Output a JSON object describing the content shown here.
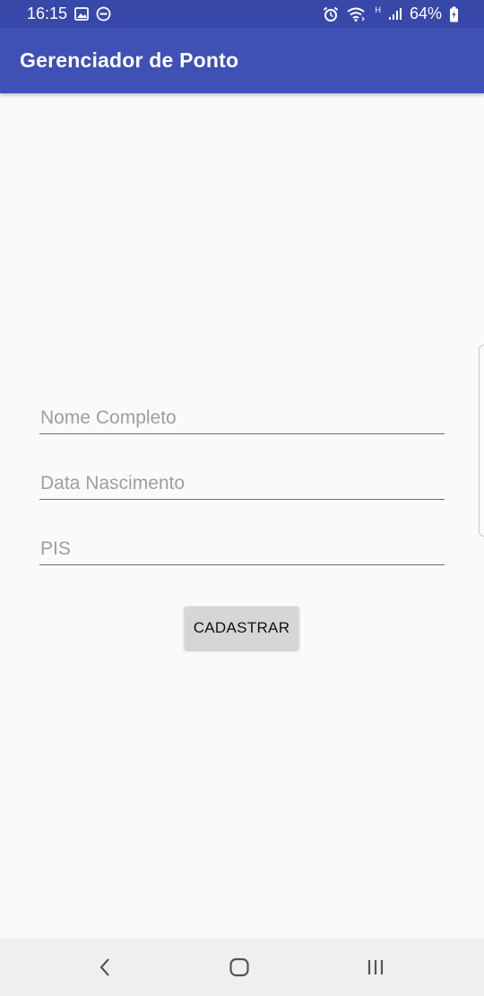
{
  "status_bar": {
    "time": "16:15",
    "battery": "64%",
    "network_label": "H",
    "icons": [
      "image-icon",
      "do-not-disturb-icon",
      "alarm-icon",
      "wifi-icon",
      "signal-icon",
      "battery-icon"
    ]
  },
  "app_bar": {
    "title": "Gerenciador de Ponto",
    "color": "#3f51b5",
    "status_color": "#3848a9"
  },
  "form": {
    "nome": {
      "placeholder": "Nome Completo",
      "value": ""
    },
    "data": {
      "placeholder": "Data Nascimento",
      "value": ""
    },
    "pis": {
      "placeholder": "PIS",
      "value": ""
    },
    "submit_label": "CADASTRAR"
  },
  "nav_bar": {
    "icons": [
      "back-icon",
      "home-icon",
      "recent-apps-icon"
    ]
  }
}
